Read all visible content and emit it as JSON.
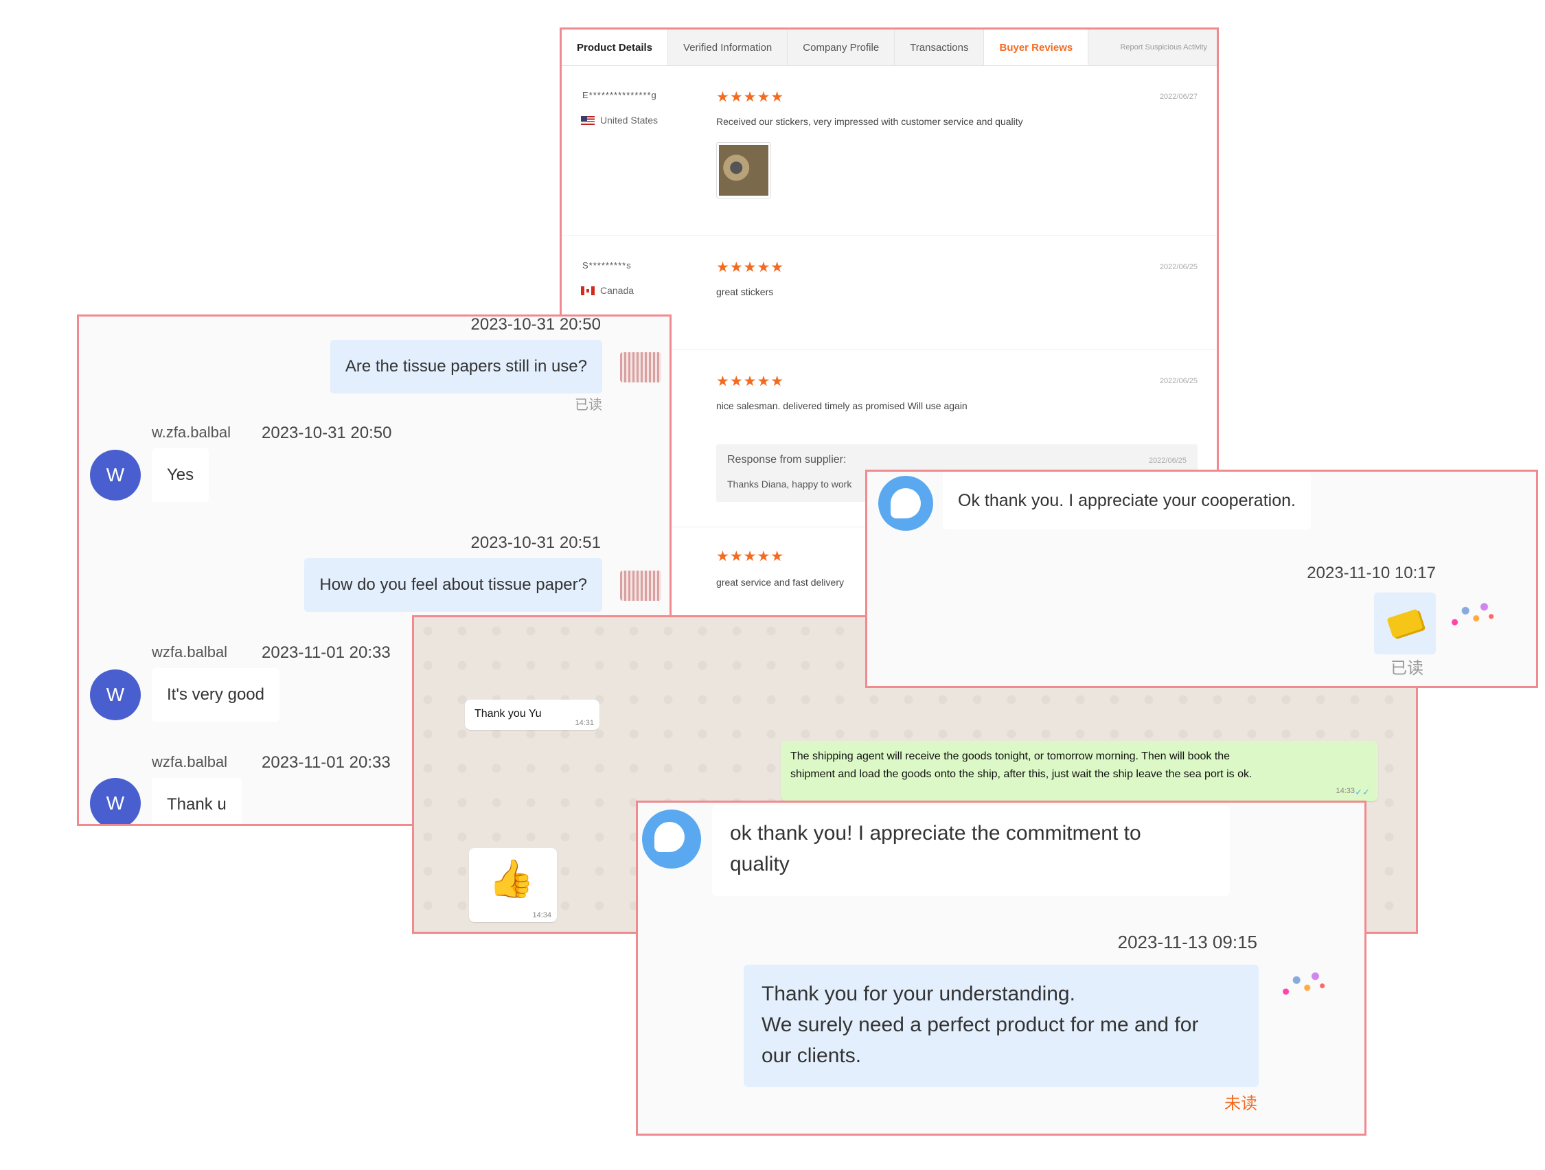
{
  "reviews": {
    "tabs": [
      "Product Details",
      "Verified Information",
      "Company Profile",
      "Transactions",
      "Buyer Reviews"
    ],
    "report_link": "Report Suspicious Activity",
    "items": [
      {
        "name": "E***************g",
        "country": "United States",
        "stars": "★★★★★",
        "date": "2022/06/27",
        "text": "Received our stickers, very impressed with customer service and quality"
      },
      {
        "name": "S*********s",
        "country": "Canada",
        "stars": "★★★★★",
        "date": "2022/06/25",
        "text": "great stickers"
      },
      {
        "stars": "★★★★★",
        "date": "2022/06/25",
        "text": "nice salesman. delivered timely as promised Will use again"
      },
      {
        "stars": "★★★★★",
        "text": "great service and fast delivery"
      }
    ],
    "response": {
      "title": "Response from supplier:",
      "date": "2022/06/25",
      "text": "Thanks Diana, happy to work"
    }
  },
  "chat1": {
    "msg1": {
      "time": "2023-10-31 20:50",
      "text": "Are the tissue papers still in use?",
      "status": "已读"
    },
    "msg2": {
      "avatar": "W",
      "sender": "w.zfa.balbal",
      "time": "2023-10-31 20:50",
      "text": "Yes"
    },
    "msg3": {
      "time": "2023-10-31 20:51",
      "text": "How do you feel about tissue paper?"
    },
    "msg4": {
      "avatar": "W",
      "sender": "wzfa.balbal",
      "time": "2023-11-01 20:33",
      "text": "It's very good"
    },
    "msg5": {
      "avatar": "W",
      "sender": "wzfa.balbal",
      "time": "2023-11-01 20:33",
      "text": "Thank u"
    }
  },
  "whatsapp": {
    "in1": {
      "text": "Thank you Yu",
      "time": "14:31"
    },
    "out1": {
      "line1": "The shipping agent will receive the goods tonight, or tomorrow morning. Then will book the",
      "line2": "shipment and load the goods onto the ship, after this, just wait the ship leave the sea port is ok.",
      "time": "14:33"
    },
    "in2": {
      "emoji": "👍",
      "time": "14:34"
    }
  },
  "chat2": {
    "text": "Ok thank you. I appreciate your cooperation.",
    "time": "2023-11-10 10:17",
    "status": "已读"
  },
  "chat3": {
    "in_line1": "ok thank you! I appreciate the commitment to",
    "in_line2": "quality",
    "time": "2023-11-13 09:15",
    "out_line1": "Thank you for your understanding.",
    "out_line2": "We surely need a perfect product for me and for",
    "out_line3": "our clients.",
    "status": "未读"
  },
  "colors": {
    "frame": "#f08a8f",
    "accent": "#f36b21",
    "avatar": "#4a5fcf",
    "bubble_me": "#e3effd",
    "wa_out": "#dcf8c6"
  }
}
